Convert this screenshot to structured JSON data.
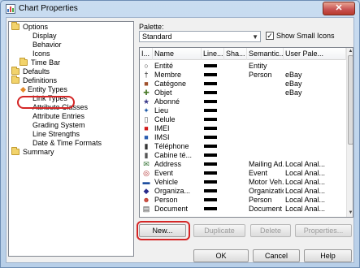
{
  "window": {
    "title": "Chart Properties",
    "close_glyph": "✕"
  },
  "tree": {
    "items": [
      {
        "label": "Options",
        "icon": "folder-icon",
        "depth": 0
      },
      {
        "label": "Display",
        "icon": "",
        "depth": 1
      },
      {
        "label": "Behavior",
        "icon": "",
        "depth": 1
      },
      {
        "label": "Icons",
        "icon": "",
        "depth": 1
      },
      {
        "label": "Time Bar",
        "icon": "folder-icon",
        "depth": 1
      },
      {
        "label": "Defaults",
        "icon": "folder-icon",
        "depth": 0
      },
      {
        "label": "Definitions",
        "icon": "folder-icon",
        "depth": 0
      },
      {
        "label": "Entity Types",
        "icon": "diamond-icon",
        "depth": 1
      },
      {
        "label": "Link Types",
        "icon": "",
        "depth": 1
      },
      {
        "label": "Attribute Classes",
        "icon": "",
        "depth": 1
      },
      {
        "label": "Attribute Entries",
        "icon": "",
        "depth": 1
      },
      {
        "label": "Grading System",
        "icon": "",
        "depth": 1
      },
      {
        "label": "Line Strengths",
        "icon": "",
        "depth": 1
      },
      {
        "label": "Date & Time Formats",
        "icon": "",
        "depth": 1
      },
      {
        "label": "Summary",
        "icon": "folder-icon",
        "depth": 0
      }
    ]
  },
  "palette": {
    "label": "Palette:",
    "value": "Standard",
    "show_small_icons_label": "Show Small Icons",
    "show_small_icons_checked": true
  },
  "grid": {
    "columns": [
      "I...",
      "Name",
      "Line...",
      "Sha...",
      "Semantic...",
      "User Pale..."
    ],
    "rows": [
      {
        "icon": "○",
        "icon_name": "entity-icon",
        "icon_color": "#333333",
        "name": "Entité",
        "sem": "Entity",
        "user": ""
      },
      {
        "icon": "†",
        "icon_name": "person-icon",
        "icon_color": "#222222",
        "name": "Membre",
        "sem": "Person",
        "user": "eBay"
      },
      {
        "icon": "■",
        "icon_name": "category-icon",
        "icon_color": "#a0522d",
        "name": "Catégone",
        "sem": "",
        "user": "eBay"
      },
      {
        "icon": "✚",
        "icon_name": "object-icon",
        "icon_color": "#4a7a2a",
        "name": "Objet",
        "sem": "",
        "user": "eBay"
      },
      {
        "icon": "★",
        "icon_name": "subscriber-icon",
        "icon_color": "#3a3a8a",
        "name": "Abonné",
        "sem": "",
        "user": ""
      },
      {
        "icon": "✦",
        "icon_name": "location-icon",
        "icon_color": "#1e5aa8",
        "name": "Lieu",
        "sem": "",
        "user": ""
      },
      {
        "icon": "▯",
        "icon_name": "cell-icon",
        "icon_color": "#555555",
        "name": "Celule",
        "sem": "",
        "user": ""
      },
      {
        "icon": "■",
        "icon_name": "imei-icon",
        "icon_color": "#d11a1a",
        "name": "IMEI",
        "sem": "",
        "user": ""
      },
      {
        "icon": "■",
        "icon_name": "imsi-icon",
        "icon_color": "#2a5db0",
        "name": "IMSI",
        "sem": "",
        "user": ""
      },
      {
        "icon": "▮",
        "icon_name": "phone-icon",
        "icon_color": "#333333",
        "name": "Téléphone",
        "sem": "",
        "user": ""
      },
      {
        "icon": "▮",
        "icon_name": "phone-booth-icon",
        "icon_color": "#555555",
        "name": "Cabine té...",
        "sem": "",
        "user": ""
      },
      {
        "icon": "✉",
        "icon_name": "address-icon",
        "icon_color": "#2d6d2d",
        "name": "Address",
        "sem": "Mailing Ad...",
        "user": "Local Anal..."
      },
      {
        "icon": "◎",
        "icon_name": "event-icon",
        "icon_color": "#b02a2a",
        "name": "Event",
        "sem": "Event",
        "user": "Local Anal..."
      },
      {
        "icon": "▬",
        "icon_name": "vehicle-icon",
        "icon_color": "#1f4fa0",
        "name": "Vehicle",
        "sem": "Motor Veh...",
        "user": "Local Anal..."
      },
      {
        "icon": "◆",
        "icon_name": "organization-icon",
        "icon_color": "#2a2a8a",
        "name": "Organiza...",
        "sem": "Organization",
        "user": "Local Anal..."
      },
      {
        "icon": "☻",
        "icon_name": "person-face-icon",
        "icon_color": "#c0392b",
        "name": "Person",
        "sem": "Person",
        "user": "Local Anal..."
      },
      {
        "icon": "▤",
        "icon_name": "document-icon",
        "icon_color": "#444444",
        "name": "Document",
        "sem": "Document",
        "user": "Local Anal..."
      }
    ]
  },
  "actions": {
    "new": "New...",
    "duplicate": "Duplicate",
    "delete": "Delete",
    "properties": "Properties..."
  },
  "footer": {
    "ok": "OK",
    "cancel": "Cancel",
    "help": "Help"
  }
}
